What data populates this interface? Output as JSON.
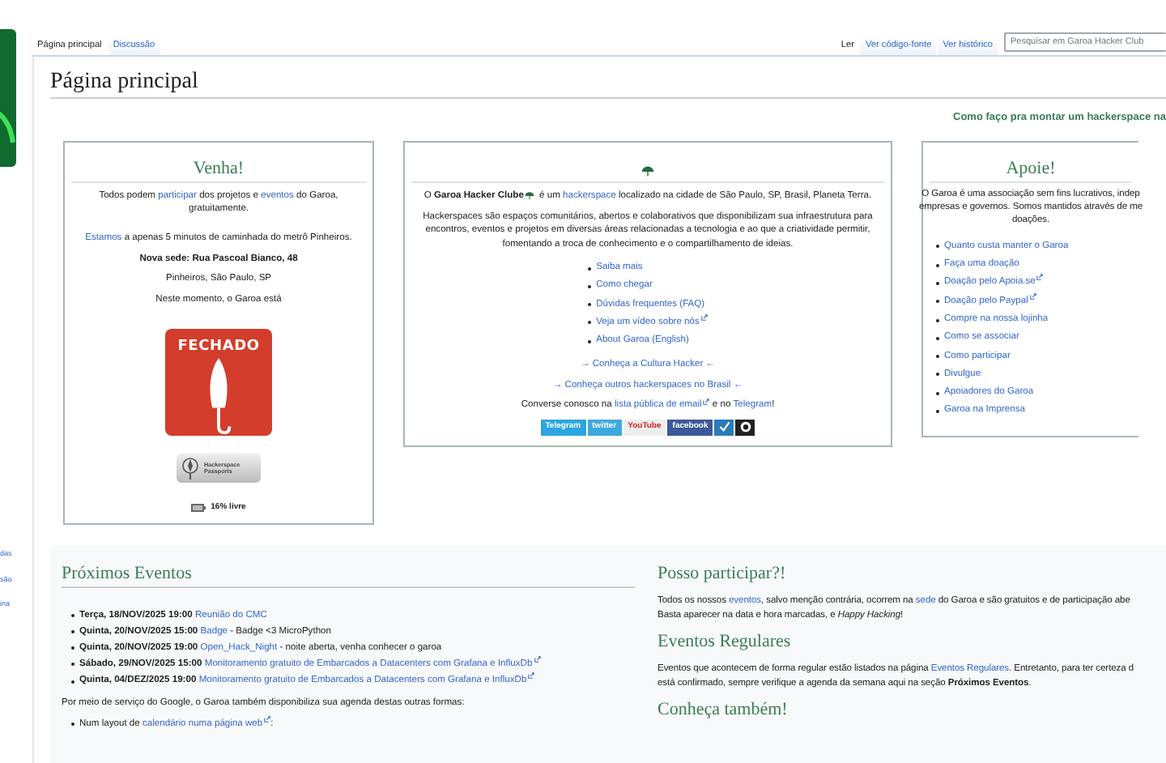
{
  "sidebar": {
    "fragments": [
      "das",
      "são",
      "ina"
    ]
  },
  "page_tabs": [
    {
      "label": "Página principal",
      "selected": true
    },
    {
      "label": "Discussão",
      "selected": false
    }
  ],
  "view_tabs": [
    {
      "label": "Ler",
      "selected": true
    },
    {
      "label": "Ver código-fonte",
      "selected": false
    },
    {
      "label": "Ver histórico",
      "selected": false
    }
  ],
  "search": {
    "placeholder": "Pesquisar em Garoa Hacker Club"
  },
  "title": "Página principal",
  "howto_link": "Como faço pra montar um hackerspace na",
  "venha": {
    "title": "Venha!",
    "paragraphs": [
      {
        "parts": [
          {
            "kind": "text",
            "text": "Todos podem "
          },
          {
            "kind": "link",
            "text": "participar"
          },
          {
            "kind": "text",
            "text": " dos projetos e "
          },
          {
            "kind": "link",
            "text": "eventos"
          },
          {
            "kind": "text",
            "text": " do Garoa, gratuitamente."
          }
        ]
      },
      {
        "parts": [
          {
            "kind": "link",
            "text": "Estamos"
          },
          {
            "kind": "text",
            "text": " a apenas 5 minutos de caminhada do metrô Pinheiros."
          }
        ]
      },
      {
        "parts": [
          {
            "kind": "bold",
            "text": "Nova sede: Rua Pascoal Bianco, 48"
          }
        ]
      },
      {
        "parts": [
          {
            "kind": "text",
            "text": "Pinheiros, São Paulo, SP"
          }
        ]
      },
      {
        "parts": [
          {
            "kind": "text",
            "text": "Neste momento, o Garoa está"
          }
        ]
      }
    ],
    "status": {
      "label": "FECHADO",
      "open": false
    },
    "passport": {
      "lines": [
        "Hackerspace",
        "Passports"
      ]
    },
    "free_space": "16% livre"
  },
  "about": {
    "intro": {
      "parts": [
        {
          "kind": "text",
          "text": "O "
        },
        {
          "kind": "bold",
          "text": "Garoa Hacker Clube"
        },
        {
          "kind": "umbrella"
        },
        {
          "kind": "text",
          "text": " é um "
        },
        {
          "kind": "link",
          "text": "hackerspace"
        },
        {
          "kind": "text",
          "text": " localizado na cidade de São Paulo, SP, Brasil, Planeta Terra."
        }
      ]
    },
    "description": {
      "parts": [
        {
          "kind": "text",
          "text": "Hackerspaces são espaços comunitários, abertos e colaborativos que disponibilizam sua infraestrutura para encontros, eventos e projetos em diversas áreas relacionadas a tecnologia e ao que a criatividade permitir, fomentando a troca de conhecimento e o compartilhamento de ideias."
        }
      ]
    },
    "links": [
      {
        "text": "Saiba mais",
        "external": false
      },
      {
        "text": "Como chegar",
        "external": false
      },
      {
        "text": "Dúvidas frequentes (FAQ)",
        "external": false
      },
      {
        "text": "Veja um vídeo sobre nós",
        "external": true
      },
      {
        "text": "About Garoa (English)",
        "external": false
      }
    ],
    "culture_links": [
      "→ Conheça a Cultura Hacker ←",
      "→ Conheça outros hackerspaces no Brasil ←"
    ],
    "contact": {
      "parts": [
        {
          "kind": "text",
          "text": "Converse conosco na "
        },
        {
          "kind": "link",
          "text": "lista pública de email",
          "external": true
        },
        {
          "kind": "text",
          "text": " e no "
        },
        {
          "kind": "link",
          "text": "Telegram"
        },
        {
          "kind": "text",
          "text": "!"
        }
      ]
    },
    "social": [
      {
        "kind": "telegram",
        "label": "Telegram"
      },
      {
        "kind": "twitter",
        "label": "twitter"
      },
      {
        "kind": "youtube",
        "label": "YouTube"
      },
      {
        "kind": "facebook",
        "label": "facebook"
      },
      {
        "kind": "check"
      },
      {
        "kind": "github"
      }
    ]
  },
  "apoie": {
    "title": "Apoie!",
    "description": {
      "lines": [
        [
          {
            "kind": "text",
            "text": "O Garoa é uma associação sem fins lucrativos, indep"
          }
        ],
        [
          {
            "kind": "text",
            "text": "empresas e governos. Somos mantidos através de me"
          }
        ],
        [
          {
            "kind": "text",
            "text": "doações."
          }
        ]
      ]
    },
    "links": [
      {
        "text": "Quanto custa manter o Garoa",
        "external": false
      },
      {
        "text": "Faça uma doação",
        "external": false
      },
      {
        "text": "Doação pelo Apoia.se",
        "external": true
      },
      {
        "text": "Doação pelo Paypal",
        "external": true
      },
      {
        "text": "Compre na nossa lojinha",
        "external": false
      },
      {
        "text": "Como se associar",
        "external": false
      },
      {
        "text": "Como participar",
        "external": false
      },
      {
        "text": "Divulgue",
        "external": false
      },
      {
        "text": "Apoiadores do Garoa",
        "external": false
      },
      {
        "text": "Garoa na Imprensa",
        "external": false
      }
    ]
  },
  "events": {
    "title": "Próximos Eventos",
    "items": [
      {
        "parts": [
          {
            "kind": "bold",
            "text": "Terça, 18/NOV/2025 19:00"
          },
          {
            "kind": "space"
          },
          {
            "kind": "link",
            "text": "Reunião do CMC"
          }
        ]
      },
      {
        "parts": [
          {
            "kind": "bold",
            "text": "Quinta, 20/NOV/2025 15:00"
          },
          {
            "kind": "space"
          },
          {
            "kind": "link",
            "text": "Badge"
          },
          {
            "kind": "text",
            "text": " - Badge <3 MicroPython"
          }
        ]
      },
      {
        "parts": [
          {
            "kind": "bold",
            "text": "Quinta, 20/NOV/2025 19:00"
          },
          {
            "kind": "space"
          },
          {
            "kind": "link",
            "text": "Open_Hack_Night"
          },
          {
            "kind": "text",
            "text": " - noite aberta, venha conhecer o garoa"
          }
        ]
      },
      {
        "parts": [
          {
            "kind": "bold",
            "text": "Sábado, 29/NOV/2025 15:00"
          },
          {
            "kind": "space"
          },
          {
            "kind": "link",
            "text": "Monitoramento gratuito de Embarcados a Datacenters com Grafana e InfluxDb",
            "external": true
          }
        ]
      },
      {
        "parts": [
          {
            "kind": "bold",
            "text": "Quinta, 04/DEZ/2025 19:00"
          },
          {
            "kind": "space"
          },
          {
            "kind": "link",
            "text": "Monitoramento gratuito de Embarcados a Datacenters com Grafana e InfluxDb",
            "external": true
          }
        ]
      }
    ],
    "note": {
      "parts": [
        {
          "kind": "text",
          "text": "Por meio de serviço do Google, o Garoa também disponibiliza sua agenda destas outras formas:"
        }
      ]
    },
    "formats": [
      {
        "parts": [
          {
            "kind": "text",
            "text": "Num layout de "
          },
          {
            "kind": "link",
            "text": "calendário numa página web",
            "external": true
          },
          {
            "kind": "text",
            "text": ":"
          }
        ]
      }
    ]
  },
  "participate": {
    "title": "Posso participar?!",
    "text": {
      "lines": [
        [
          {
            "kind": "text",
            "text": "Todos os nossos "
          },
          {
            "kind": "link",
            "text": "eventos"
          },
          {
            "kind": "text",
            "text": ", salvo menção contrária, ocorrem na "
          },
          {
            "kind": "link",
            "text": "sede"
          },
          {
            "kind": "text",
            "text": " do Garoa e são gratuitos e de participação abe"
          }
        ],
        [
          {
            "kind": "text",
            "text": "Basta aparecer na data e hora marcadas, e "
          },
          {
            "kind": "italic",
            "text": "Happy Hacking"
          },
          {
            "kind": "text",
            "text": "!"
          }
        ]
      ]
    }
  },
  "regular": {
    "title": "Eventos Regulares",
    "text": {
      "lines": [
        [
          {
            "kind": "text",
            "text": "Eventos que acontecem de forma regular estão listados na página "
          },
          {
            "kind": "link",
            "text": "Eventos Regulares"
          },
          {
            "kind": "text",
            "text": ". Entretanto, para ter certeza d"
          }
        ],
        [
          {
            "kind": "text",
            "text": "está confirmado, sempre verifique a agenda da semana aqui na seção "
          },
          {
            "kind": "bold",
            "text": "Próximos Eventos"
          },
          {
            "kind": "text",
            "text": "."
          }
        ]
      ]
    }
  },
  "more": {
    "title": "Conheça também!"
  }
}
